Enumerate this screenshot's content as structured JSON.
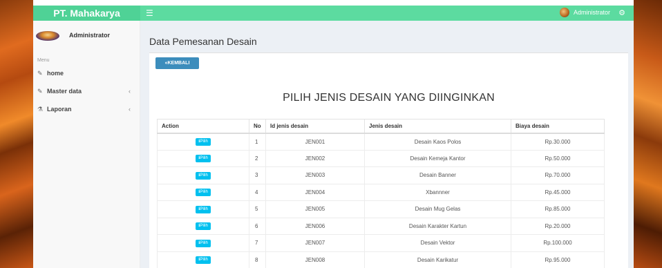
{
  "header": {
    "brand": "PT. Mahakarya",
    "menu_toggle_icon": "hamburger-icon",
    "user_name": "Administrator",
    "settings_icon": "gears-icon",
    "color": "#5cdba0"
  },
  "sidebar": {
    "user_name": "Administrator",
    "menu_header": "Menu",
    "items": [
      {
        "label": "home",
        "icon": "edit-icon",
        "has_children": false
      },
      {
        "label": "Master data",
        "icon": "edit-icon",
        "has_children": true
      },
      {
        "label": "Laporan",
        "icon": "sitemap-icon",
        "has_children": true
      }
    ]
  },
  "main": {
    "page_title": "Data Pemesanan Desain",
    "back_button": "KEMBALI",
    "heading": "PILIH JENIS DESAIN YANG DIINGINKAN",
    "table": {
      "columns": [
        "Action",
        "No",
        "Id jenis desain",
        "Jenis desain",
        "Biaya desain"
      ],
      "action_label": "Pilih",
      "rows": [
        {
          "no": "1",
          "id": "JEN001",
          "jenis": "Desain Kaos Polos",
          "biaya": "Rp.30.000"
        },
        {
          "no": "2",
          "id": "JEN002",
          "jenis": "Desain Kemeja Kantor",
          "biaya": "Rp.50.000"
        },
        {
          "no": "3",
          "id": "JEN003",
          "jenis": "Desain Banner",
          "biaya": "Rp.70.000"
        },
        {
          "no": "4",
          "id": "JEN004",
          "jenis": "Xbannner",
          "biaya": "Rp.45.000"
        },
        {
          "no": "5",
          "id": "JEN005",
          "jenis": "Desain Mug Gelas",
          "biaya": "Rp.85.000"
        },
        {
          "no": "6",
          "id": "JEN006",
          "jenis": "Desain Karakter Kartun",
          "biaya": "Rp.20.000"
        },
        {
          "no": "7",
          "id": "JEN007",
          "jenis": "Desain Vektor",
          "biaya": "Rp.100.000"
        },
        {
          "no": "8",
          "id": "JEN008",
          "jenis": "Desain Karikatur",
          "biaya": "Rp.95.000"
        }
      ]
    }
  }
}
